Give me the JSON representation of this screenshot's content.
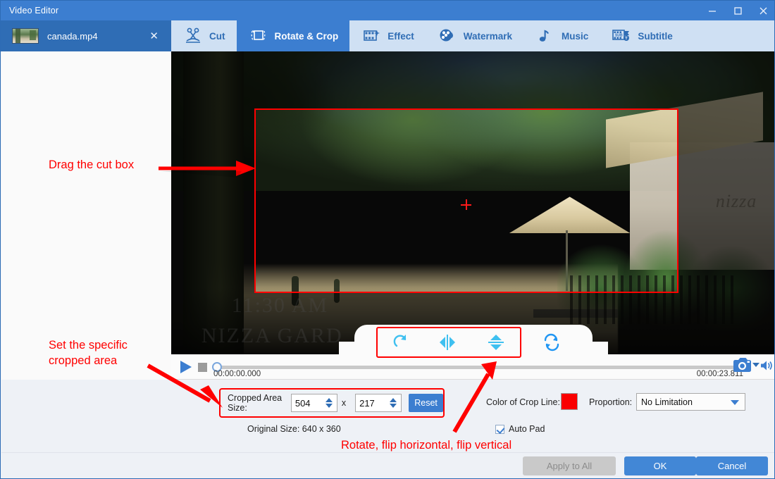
{
  "window": {
    "title": "Video Editor",
    "controls": [
      {
        "name": "minimize",
        "glyph": "—"
      },
      {
        "name": "maximize",
        "glyph": "□"
      },
      {
        "name": "close",
        "glyph": "✕"
      }
    ]
  },
  "file_tab": {
    "filename": "canada.mp4",
    "close_label": "✕"
  },
  "tabs": [
    {
      "id": "cut",
      "label": "Cut",
      "icon": "scissors-icon",
      "active": false
    },
    {
      "id": "rotate-crop",
      "label": "Rotate & Crop",
      "icon": "crop-icon",
      "active": true
    },
    {
      "id": "effect",
      "label": "Effect",
      "icon": "film-star-icon",
      "active": false
    },
    {
      "id": "watermark",
      "label": "Watermark",
      "icon": "droplet-icon",
      "active": false
    },
    {
      "id": "music",
      "label": "Music",
      "icon": "music-note-icon",
      "active": false
    },
    {
      "id": "subtitle",
      "label": "Subtitle",
      "icon": "subtitle-icon",
      "active": false
    }
  ],
  "preview": {
    "watermark_time": "11:30 AM",
    "watermark_place": "NIZZA GARD",
    "building_sign": "nizza",
    "crop_line_color": "#ff0000"
  },
  "rotate_tools": [
    {
      "id": "rotate",
      "icon": "rotate-clockwise-icon"
    },
    {
      "id": "flip-horizontal",
      "icon": "flip-horizontal-icon"
    },
    {
      "id": "flip-vertical",
      "icon": "flip-vertical-icon"
    },
    {
      "id": "reset-rotation",
      "icon": "refresh-icon"
    }
  ],
  "player": {
    "play_icon": "play-icon",
    "stop_icon": "stop-icon",
    "current_time": "00:00:00.000",
    "total_time": "00:00:23.811",
    "snapshot_icon": "camera-icon",
    "snapshot_caret_icon": "chevron-down-icon",
    "volume_icon": "speaker-icon",
    "progress_percent": 0
  },
  "settings": {
    "cropped_area_label": "Cropped Area Size:",
    "crop_width": "504",
    "crop_height": "217",
    "dimension_separator": "x",
    "reset_label": "Reset",
    "original_size": "Original Size: 640 x 360",
    "color_of_crop_line_label": "Color of Crop Line:",
    "crop_line_color": "#fa0000",
    "proportion_label": "Proportion:",
    "proportion_value": "No Limitation",
    "proportion_options": [
      "No Limitation"
    ],
    "auto_pad_label": "Auto Pad",
    "auto_pad_checked": true
  },
  "footer": {
    "apply_to_all": "Apply to All",
    "ok": "OK",
    "cancel": "Cancel"
  },
  "annotations": {
    "drag_cut_box": "Drag the cut box",
    "set_cropped_area": "Set the specific\ncropped area",
    "rotate_flip": "Rotate, flip horizontal, flip vertical"
  }
}
